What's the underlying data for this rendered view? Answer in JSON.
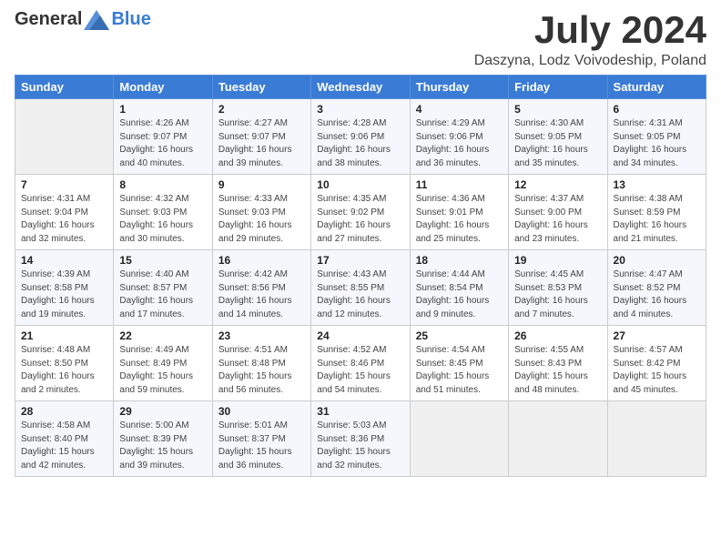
{
  "header": {
    "logo_general": "General",
    "logo_blue": "Blue",
    "month": "July 2024",
    "location": "Daszyna, Lodz Voivodeship, Poland"
  },
  "weekdays": [
    "Sunday",
    "Monday",
    "Tuesday",
    "Wednesday",
    "Thursday",
    "Friday",
    "Saturday"
  ],
  "weeks": [
    [
      {
        "day": "",
        "empty": true
      },
      {
        "day": "1",
        "sunrise": "4:26 AM",
        "sunset": "9:07 PM",
        "daylight": "16 hours and 40 minutes."
      },
      {
        "day": "2",
        "sunrise": "4:27 AM",
        "sunset": "9:07 PM",
        "daylight": "16 hours and 39 minutes."
      },
      {
        "day": "3",
        "sunrise": "4:28 AM",
        "sunset": "9:06 PM",
        "daylight": "16 hours and 38 minutes."
      },
      {
        "day": "4",
        "sunrise": "4:29 AM",
        "sunset": "9:06 PM",
        "daylight": "16 hours and 36 minutes."
      },
      {
        "day": "5",
        "sunrise": "4:30 AM",
        "sunset": "9:05 PM",
        "daylight": "16 hours and 35 minutes."
      },
      {
        "day": "6",
        "sunrise": "4:31 AM",
        "sunset": "9:05 PM",
        "daylight": "16 hours and 34 minutes."
      }
    ],
    [
      {
        "day": "7",
        "sunrise": "4:31 AM",
        "sunset": "9:04 PM",
        "daylight": "16 hours and 32 minutes."
      },
      {
        "day": "8",
        "sunrise": "4:32 AM",
        "sunset": "9:03 PM",
        "daylight": "16 hours and 30 minutes."
      },
      {
        "day": "9",
        "sunrise": "4:33 AM",
        "sunset": "9:03 PM",
        "daylight": "16 hours and 29 minutes."
      },
      {
        "day": "10",
        "sunrise": "4:35 AM",
        "sunset": "9:02 PM",
        "daylight": "16 hours and 27 minutes."
      },
      {
        "day": "11",
        "sunrise": "4:36 AM",
        "sunset": "9:01 PM",
        "daylight": "16 hours and 25 minutes."
      },
      {
        "day": "12",
        "sunrise": "4:37 AM",
        "sunset": "9:00 PM",
        "daylight": "16 hours and 23 minutes."
      },
      {
        "day": "13",
        "sunrise": "4:38 AM",
        "sunset": "8:59 PM",
        "daylight": "16 hours and 21 minutes."
      }
    ],
    [
      {
        "day": "14",
        "sunrise": "4:39 AM",
        "sunset": "8:58 PM",
        "daylight": "16 hours and 19 minutes."
      },
      {
        "day": "15",
        "sunrise": "4:40 AM",
        "sunset": "8:57 PM",
        "daylight": "16 hours and 17 minutes."
      },
      {
        "day": "16",
        "sunrise": "4:42 AM",
        "sunset": "8:56 PM",
        "daylight": "16 hours and 14 minutes."
      },
      {
        "day": "17",
        "sunrise": "4:43 AM",
        "sunset": "8:55 PM",
        "daylight": "16 hours and 12 minutes."
      },
      {
        "day": "18",
        "sunrise": "4:44 AM",
        "sunset": "8:54 PM",
        "daylight": "16 hours and 9 minutes."
      },
      {
        "day": "19",
        "sunrise": "4:45 AM",
        "sunset": "8:53 PM",
        "daylight": "16 hours and 7 minutes."
      },
      {
        "day": "20",
        "sunrise": "4:47 AM",
        "sunset": "8:52 PM",
        "daylight": "16 hours and 4 minutes."
      }
    ],
    [
      {
        "day": "21",
        "sunrise": "4:48 AM",
        "sunset": "8:50 PM",
        "daylight": "16 hours and 2 minutes."
      },
      {
        "day": "22",
        "sunrise": "4:49 AM",
        "sunset": "8:49 PM",
        "daylight": "15 hours and 59 minutes."
      },
      {
        "day": "23",
        "sunrise": "4:51 AM",
        "sunset": "8:48 PM",
        "daylight": "15 hours and 56 minutes."
      },
      {
        "day": "24",
        "sunrise": "4:52 AM",
        "sunset": "8:46 PM",
        "daylight": "15 hours and 54 minutes."
      },
      {
        "day": "25",
        "sunrise": "4:54 AM",
        "sunset": "8:45 PM",
        "daylight": "15 hours and 51 minutes."
      },
      {
        "day": "26",
        "sunrise": "4:55 AM",
        "sunset": "8:43 PM",
        "daylight": "15 hours and 48 minutes."
      },
      {
        "day": "27",
        "sunrise": "4:57 AM",
        "sunset": "8:42 PM",
        "daylight": "15 hours and 45 minutes."
      }
    ],
    [
      {
        "day": "28",
        "sunrise": "4:58 AM",
        "sunset": "8:40 PM",
        "daylight": "15 hours and 42 minutes."
      },
      {
        "day": "29",
        "sunrise": "5:00 AM",
        "sunset": "8:39 PM",
        "daylight": "15 hours and 39 minutes."
      },
      {
        "day": "30",
        "sunrise": "5:01 AM",
        "sunset": "8:37 PM",
        "daylight": "15 hours and 36 minutes."
      },
      {
        "day": "31",
        "sunrise": "5:03 AM",
        "sunset": "8:36 PM",
        "daylight": "15 hours and 32 minutes."
      },
      {
        "day": "",
        "empty": true
      },
      {
        "day": "",
        "empty": true
      },
      {
        "day": "",
        "empty": true
      }
    ]
  ]
}
